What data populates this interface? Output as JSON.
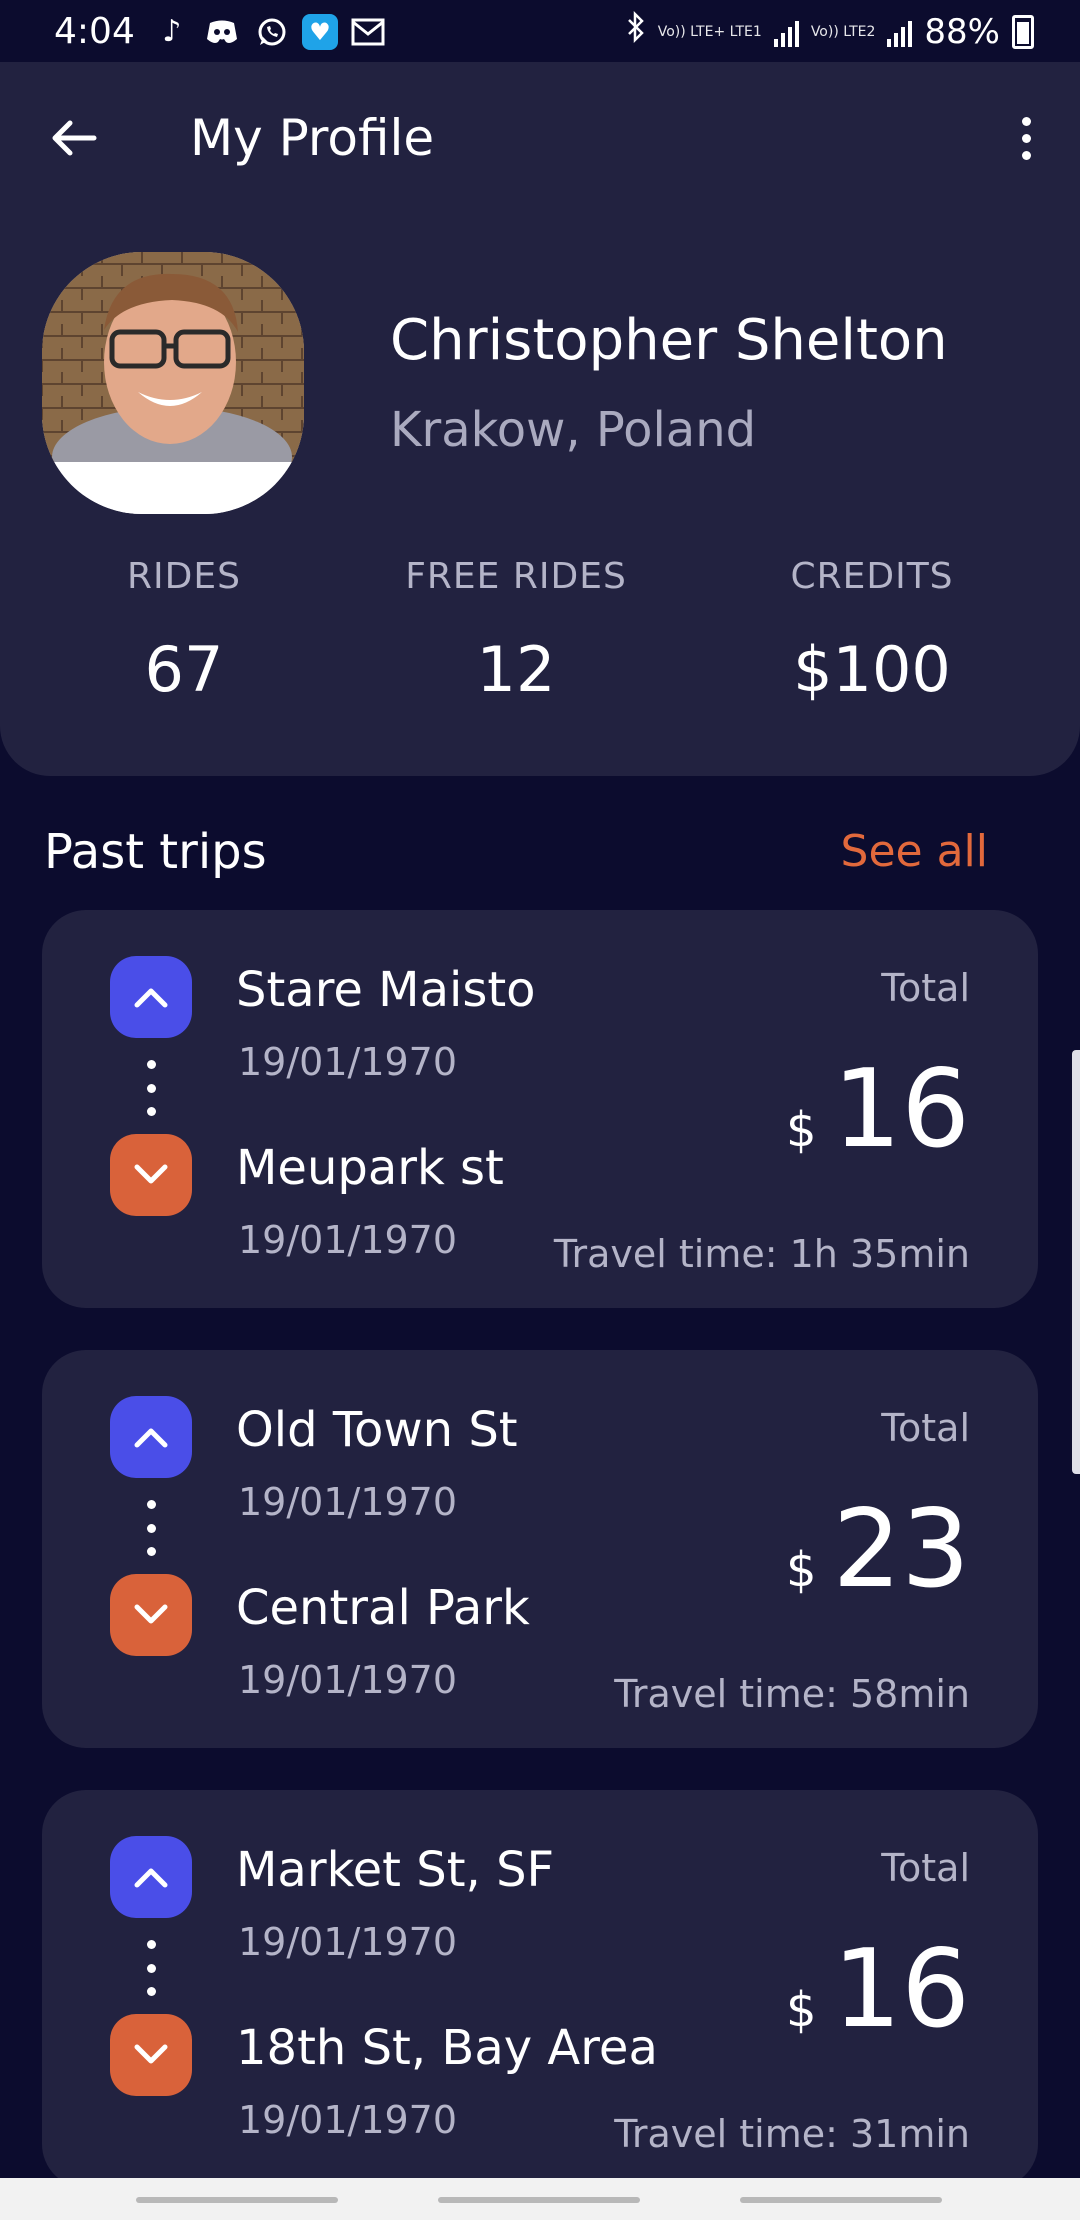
{
  "status_bar": {
    "time": "4:04",
    "battery": "88%",
    "lte1": "Vo)) LTE+ LTE1",
    "lte2": "Vo)) LTE2"
  },
  "toolbar": {
    "title": "My Profile",
    "back_icon": "arrow-left-icon",
    "menu_icon": "more-vertical-icon"
  },
  "profile": {
    "name": "Christopher Shelton",
    "location": "Krakow, Poland"
  },
  "stats": [
    {
      "label": "RIDES",
      "value": "67"
    },
    {
      "label": "FREE RIDES",
      "value": "12"
    },
    {
      "label": "CREDITS",
      "value": "$100"
    }
  ],
  "past_trips": {
    "title": "Past trips",
    "see_all": "See all",
    "trips": [
      {
        "from": "Stare Maisto",
        "from_date": "19/01/1970",
        "to": "Meupark st",
        "to_date": "19/01/1970",
        "total_label": "Total",
        "currency": "$",
        "amount": "16",
        "travel_time": "Travel time: 1h 35min"
      },
      {
        "from": "Old Town St",
        "from_date": "19/01/1970",
        "to": "Central Park",
        "to_date": "19/01/1970",
        "total_label": "Total",
        "currency": "$",
        "amount": "23",
        "travel_time": "Travel time:  58min"
      },
      {
        "from": "Market St, SF",
        "from_date": "19/01/1970",
        "to": "18th St, Bay Area",
        "to_date": "19/01/1970",
        "total_label": "Total",
        "currency": "$",
        "amount": "16",
        "travel_time": "Travel time:  31min"
      }
    ]
  },
  "colors": {
    "background": "#0c0c2e",
    "card": "#222240",
    "accent_orange": "#e2693c",
    "up_button": "#4a4ee8",
    "down_button": "#d9623a",
    "muted_text": "#b4b4c8"
  }
}
